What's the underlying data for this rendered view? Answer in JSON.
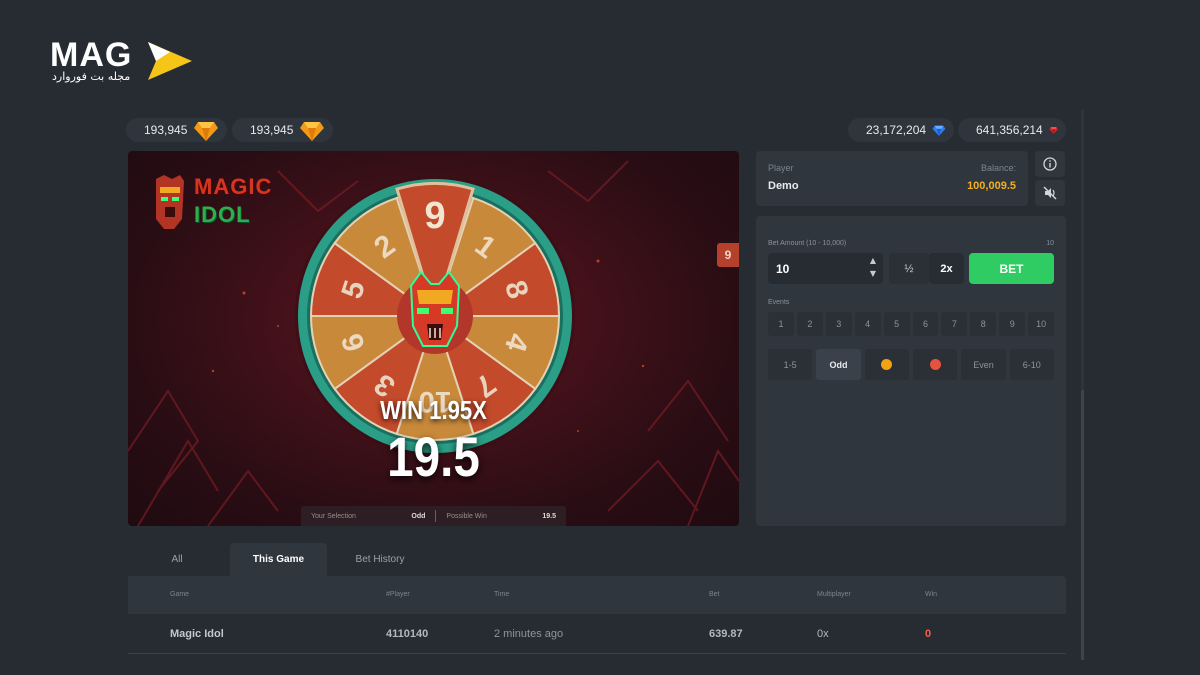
{
  "brand": {
    "logo_text": "MAG",
    "logo_subtitle": "مجله بت فوروارد",
    "accent": "#f5c518"
  },
  "balances": [
    {
      "value": "193,945",
      "gem": "orange-gem-icon",
      "color": "#f29a17"
    },
    {
      "value": "193,945",
      "gem": "orange-gem-icon",
      "color": "#f29a17"
    },
    {
      "value": "23,172,204",
      "gem": "blue-gem-icon",
      "color": "#2f7ff0"
    },
    {
      "value": "641,356,214",
      "gem": "red-gem-icon",
      "color": "#d9262c"
    }
  ],
  "game": {
    "title_line1": "MAGIC",
    "title_line2": "IDOL",
    "last_result": "9",
    "wheel_numbers": [
      "9",
      "1",
      "8",
      "4",
      "7",
      "10",
      "3",
      "6",
      "5",
      "2"
    ],
    "win_label": "WIN 1.95X",
    "win_amount": "19.5",
    "selection_label": "Your Selection",
    "selection_value": "Odd",
    "possible_win_label": "Possible Win",
    "possible_win_value": "19.5"
  },
  "player": {
    "label": "Player",
    "name": "Demo",
    "balance_label": "Balance:",
    "balance": "100,009.5"
  },
  "bet": {
    "amount_label": "Bet Amount (10 - 10,000)",
    "amount_max": "10",
    "amount_value": "10",
    "half_label": "½",
    "double_label": "2x",
    "bet_label": "BET",
    "bet_color": "#2ecc62",
    "events_label": "Events",
    "events": [
      "1",
      "2",
      "3",
      "4",
      "5",
      "6",
      "7",
      "8",
      "9",
      "10"
    ],
    "groups": [
      {
        "label": "1-5",
        "type": "text"
      },
      {
        "label": "Odd",
        "type": "text",
        "active": true
      },
      {
        "label": "",
        "type": "dot",
        "color": "#f2a30f"
      },
      {
        "label": "",
        "type": "dot",
        "color": "#e4533f"
      },
      {
        "label": "Even",
        "type": "text"
      },
      {
        "label": "6-10",
        "type": "text"
      }
    ]
  },
  "tabs": [
    {
      "label": "All"
    },
    {
      "label": "This Game",
      "active": true
    },
    {
      "label": "Bet History"
    }
  ],
  "table": {
    "headers": [
      "Game",
      "#Player",
      "Time",
      "Bet",
      "Multiplayer",
      "Win"
    ],
    "rows": [
      {
        "game": "Magic Idol",
        "player": "4110140",
        "time": "2 minutes ago",
        "bet": "639.87",
        "multiplier": "0x",
        "win": "0",
        "win_color": "#f0614f"
      }
    ]
  }
}
